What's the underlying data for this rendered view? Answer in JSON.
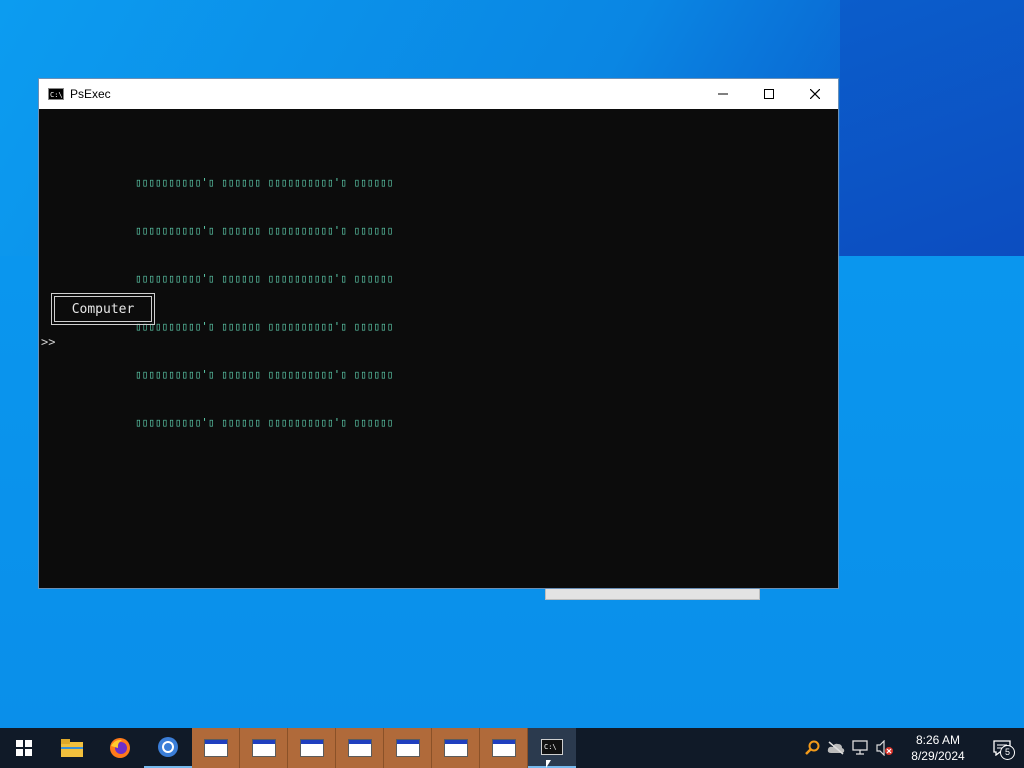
{
  "window": {
    "title": "PsExec",
    "app_icon_text": "C:\\",
    "controls": {
      "minimize": "—",
      "maximize": "☐",
      "close": "✕"
    }
  },
  "console": {
    "ascii_lines": [
      "▯▯▯▯▯▯▯▯▯▯'▯ ▯▯▯▯▯▯ ▯▯▯▯▯▯▯▯▯▯'▯ ▯▯▯▯▯▯",
      "▯▯▯▯▯▯▯▯▯▯'▯ ▯▯▯▯▯▯ ▯▯▯▯▯▯▯▯▯▯'▯ ▯▯▯▯▯▯",
      "▯▯▯▯▯▯▯▯▯▯'▯ ▯▯▯▯▯▯ ▯▯▯▯▯▯▯▯▯▯'▯ ▯▯▯▯▯▯",
      "▯▯▯▯▯▯▯▯▯▯'▯ ▯▯▯▯▯▯ ▯▯▯▯▯▯▯▯▯▯'▯ ▯▯▯▯▯▯",
      "▯▯▯▯▯▯▯▯▯▯'▯ ▯▯▯▯▯▯ ▯▯▯▯▯▯▯▯▯▯'▯ ▯▯▯▯▯▯",
      "▯▯▯▯▯▯▯▯▯▯'▯ ▯▯▯▯▯▯ ▯▯▯▯▯▯▯▯▯▯'▯ ▯▯▯▯▯▯"
    ],
    "button_label": "Computer",
    "prompt": ">>"
  },
  "taskbar": {
    "start_icon": "windows-start-icon",
    "pinned": [
      "file-explorer-icon",
      "firefox-icon",
      "chrome-icon"
    ],
    "open_windows_count": 7,
    "active_app_icon_text": "C:\\",
    "clock": {
      "time": "8:26 AM",
      "date": "8/29/2024"
    },
    "notification_count": "5"
  },
  "colors": {
    "console_bg": "#0c0c0c",
    "ascii_text": "#5fd1b0",
    "taskbar_bg": "#101a28",
    "taskbar_group": "#b06a3a"
  }
}
